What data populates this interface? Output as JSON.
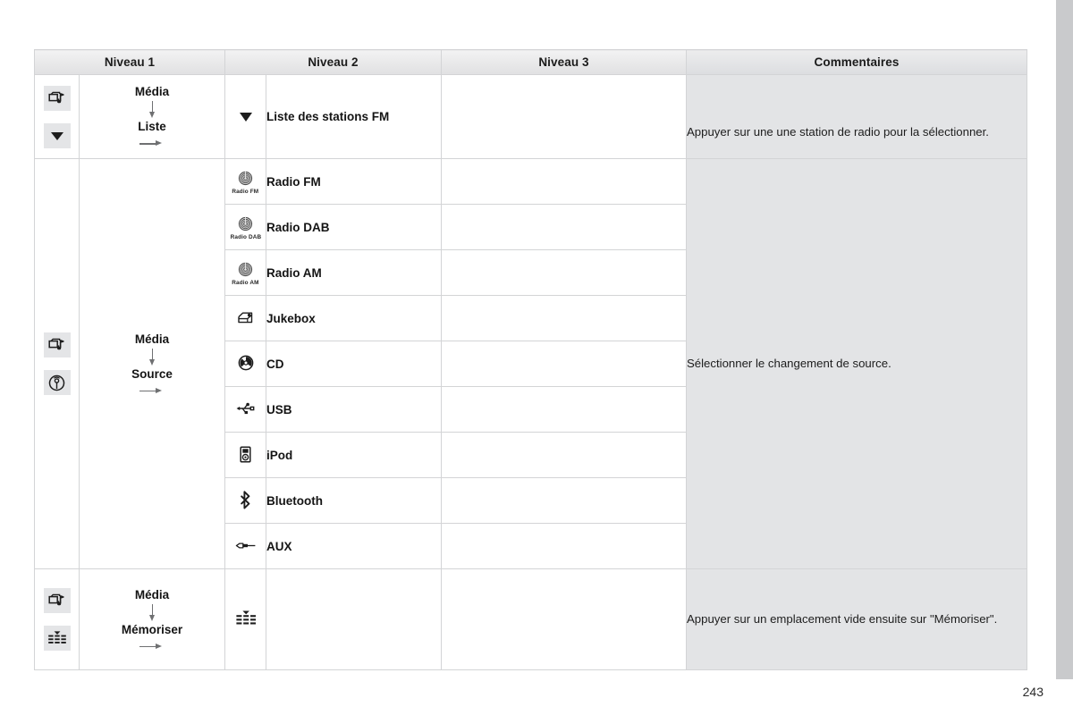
{
  "document": {
    "page_number": "243"
  },
  "table": {
    "headers": {
      "level1": "Niveau 1",
      "level2": "Niveau 2",
      "level3": "Niveau 3",
      "comments": "Commentaires"
    },
    "groups": [
      {
        "id": "liste",
        "icons": [
          "media-music-icon",
          "triangle-down-icon"
        ],
        "path": {
          "from": "Média",
          "to": "Liste"
        },
        "comment": "Appuyer sur une une station de radio pour la sélectionner.",
        "rows": [
          {
            "icon": "triangle-down-icon",
            "icon_caption": "",
            "label": "Liste des stations FM",
            "level3": ""
          }
        ]
      },
      {
        "id": "source",
        "icons": [
          "media-music-icon",
          "source-antenna-icon"
        ],
        "path": {
          "from": "Média",
          "to": "Source"
        },
        "comment": "Sélectionner le changement de source.",
        "rows": [
          {
            "icon": "radio-dial-icon",
            "icon_caption": "Radio FM",
            "label": "Radio FM",
            "level3": ""
          },
          {
            "icon": "radio-dial-icon",
            "icon_caption": "Radio DAB",
            "label": "Radio DAB",
            "level3": ""
          },
          {
            "icon": "radio-dial-icon",
            "icon_caption": "Radio AM",
            "label": "Radio AM",
            "level3": ""
          },
          {
            "icon": "jukebox-icon",
            "icon_caption": "",
            "label": "Jukebox",
            "level3": ""
          },
          {
            "icon": "cd-icon",
            "icon_caption": "",
            "label": "CD",
            "level3": ""
          },
          {
            "icon": "usb-icon",
            "icon_caption": "",
            "label": "USB",
            "level3": ""
          },
          {
            "icon": "ipod-icon",
            "icon_caption": "",
            "label": "iPod",
            "level3": ""
          },
          {
            "icon": "bluetooth-icon",
            "icon_caption": "",
            "label": "Bluetooth",
            "level3": ""
          },
          {
            "icon": "aux-jack-icon",
            "icon_caption": "",
            "label": "AUX",
            "level3": ""
          }
        ]
      },
      {
        "id": "memoriser",
        "icons": [
          "media-music-icon",
          "presets-equalizer-icon"
        ],
        "path": {
          "from": "Média",
          "to": "Mémoriser"
        },
        "comment": "Appuyer sur un emplacement vide ensuite sur \"Mémoriser\".",
        "rows": [
          {
            "icon": "presets-equalizer-icon",
            "icon_caption": "",
            "label": "",
            "level3": ""
          }
        ]
      }
    ]
  },
  "colors": {
    "comment_background": "#e3e4e6",
    "header_background": "#e8e8e9",
    "border": "#d3d4d6",
    "chip_background": "#e4e5e7",
    "edge_tab": "#c9cacc",
    "arrow": "#6f7072"
  }
}
